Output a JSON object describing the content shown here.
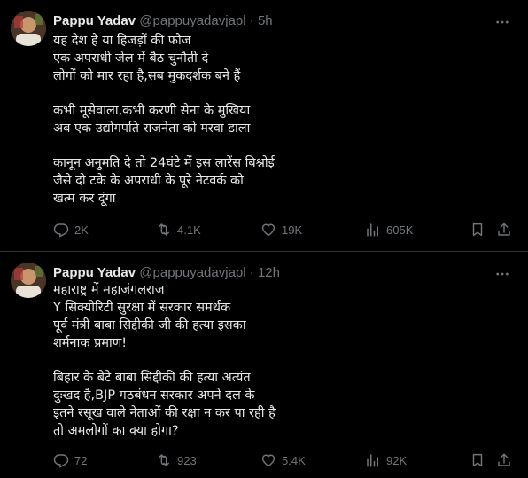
{
  "tweets": [
    {
      "author_name": "Pappu Yadav",
      "author_handle": "@pappuyadavjapl",
      "dot": "·",
      "time": "5h",
      "lines": [
        "यह देश है या हिजड़ों की फौज",
        "एक अपराधी जेल में बैठ चुनौती दे",
        "लोगों को मार रहा है,सब मुकदर्शक बने हैं",
        "",
        "कभी मूसेवाला,कभी करणी सेना के मुखिया",
        "अब एक उद्योगपति राजनेता को मरवा डाला",
        "",
        "कानून अनुमति दे तो 24घंटे में इस लारेंस बिश्नोई",
        "जैसे दो टके के अपराधी के पूरे नेटवर्क को",
        "खत्म कर दूंगा"
      ],
      "replies": "2K",
      "reposts": "4.1K",
      "likes": "19K",
      "views": "605K"
    },
    {
      "author_name": "Pappu Yadav",
      "author_handle": "@pappuyadavjapl",
      "dot": "·",
      "time": "12h",
      "lines": [
        "महाराष्ट्र में महाजंगलराज",
        "Y सिक्योरिटी सुरक्षा में सरकार समर्थक",
        "पूर्व मंत्री बाबा सिद्दीकी जी की हत्या इसका",
        "शर्मनाक प्रमाण!",
        "",
        "बिहार के बेटे बाबा सिद्दीकी की हत्या अत्यंत",
        "दुःखद है,BJP गठबंधन सरकार अपने दल के",
        "इतने रसूख वाले नेताओं की रक्षा न कर पा रही है",
        "तो अमलोगों का क्या होगा?"
      ],
      "replies": "72",
      "reposts": "923",
      "likes": "5.4K",
      "views": "92K"
    }
  ],
  "colors": {
    "background": "#000000",
    "text": "#e7e9ea",
    "muted": "#71767b",
    "divider": "#2f3336"
  },
  "icons": {
    "more": "more-icon",
    "reply": "reply-icon",
    "repost": "repost-icon",
    "like": "heart-icon",
    "views": "views-icon",
    "bookmark": "bookmark-icon",
    "share": "share-icon"
  }
}
